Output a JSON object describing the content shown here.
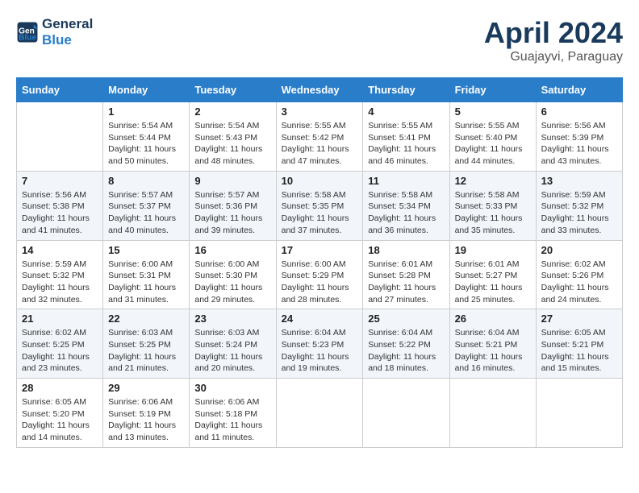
{
  "header": {
    "logo_line1": "General",
    "logo_line2": "Blue",
    "month_title": "April 2024",
    "subtitle": "Guajayvi, Paraguay"
  },
  "weekdays": [
    "Sunday",
    "Monday",
    "Tuesday",
    "Wednesday",
    "Thursday",
    "Friday",
    "Saturday"
  ],
  "weeks": [
    [
      null,
      {
        "day": 1,
        "sunrise": "5:54 AM",
        "sunset": "5:44 PM",
        "daylight": "11 hours and 50 minutes."
      },
      {
        "day": 2,
        "sunrise": "5:54 AM",
        "sunset": "5:43 PM",
        "daylight": "11 hours and 48 minutes."
      },
      {
        "day": 3,
        "sunrise": "5:55 AM",
        "sunset": "5:42 PM",
        "daylight": "11 hours and 47 minutes."
      },
      {
        "day": 4,
        "sunrise": "5:55 AM",
        "sunset": "5:41 PM",
        "daylight": "11 hours and 46 minutes."
      },
      {
        "day": 5,
        "sunrise": "5:55 AM",
        "sunset": "5:40 PM",
        "daylight": "11 hours and 44 minutes."
      },
      {
        "day": 6,
        "sunrise": "5:56 AM",
        "sunset": "5:39 PM",
        "daylight": "11 hours and 43 minutes."
      }
    ],
    [
      {
        "day": 7,
        "sunrise": "5:56 AM",
        "sunset": "5:38 PM",
        "daylight": "11 hours and 41 minutes."
      },
      {
        "day": 8,
        "sunrise": "5:57 AM",
        "sunset": "5:37 PM",
        "daylight": "11 hours and 40 minutes."
      },
      {
        "day": 9,
        "sunrise": "5:57 AM",
        "sunset": "5:36 PM",
        "daylight": "11 hours and 39 minutes."
      },
      {
        "day": 10,
        "sunrise": "5:58 AM",
        "sunset": "5:35 PM",
        "daylight": "11 hours and 37 minutes."
      },
      {
        "day": 11,
        "sunrise": "5:58 AM",
        "sunset": "5:34 PM",
        "daylight": "11 hours and 36 minutes."
      },
      {
        "day": 12,
        "sunrise": "5:58 AM",
        "sunset": "5:33 PM",
        "daylight": "11 hours and 35 minutes."
      },
      {
        "day": 13,
        "sunrise": "5:59 AM",
        "sunset": "5:32 PM",
        "daylight": "11 hours and 33 minutes."
      }
    ],
    [
      {
        "day": 14,
        "sunrise": "5:59 AM",
        "sunset": "5:32 PM",
        "daylight": "11 hours and 32 minutes."
      },
      {
        "day": 15,
        "sunrise": "6:00 AM",
        "sunset": "5:31 PM",
        "daylight": "11 hours and 31 minutes."
      },
      {
        "day": 16,
        "sunrise": "6:00 AM",
        "sunset": "5:30 PM",
        "daylight": "11 hours and 29 minutes."
      },
      {
        "day": 17,
        "sunrise": "6:00 AM",
        "sunset": "5:29 PM",
        "daylight": "11 hours and 28 minutes."
      },
      {
        "day": 18,
        "sunrise": "6:01 AM",
        "sunset": "5:28 PM",
        "daylight": "11 hours and 27 minutes."
      },
      {
        "day": 19,
        "sunrise": "6:01 AM",
        "sunset": "5:27 PM",
        "daylight": "11 hours and 25 minutes."
      },
      {
        "day": 20,
        "sunrise": "6:02 AM",
        "sunset": "5:26 PM",
        "daylight": "11 hours and 24 minutes."
      }
    ],
    [
      {
        "day": 21,
        "sunrise": "6:02 AM",
        "sunset": "5:25 PM",
        "daylight": "11 hours and 23 minutes."
      },
      {
        "day": 22,
        "sunrise": "6:03 AM",
        "sunset": "5:25 PM",
        "daylight": "11 hours and 21 minutes."
      },
      {
        "day": 23,
        "sunrise": "6:03 AM",
        "sunset": "5:24 PM",
        "daylight": "11 hours and 20 minutes."
      },
      {
        "day": 24,
        "sunrise": "6:04 AM",
        "sunset": "5:23 PM",
        "daylight": "11 hours and 19 minutes."
      },
      {
        "day": 25,
        "sunrise": "6:04 AM",
        "sunset": "5:22 PM",
        "daylight": "11 hours and 18 minutes."
      },
      {
        "day": 26,
        "sunrise": "6:04 AM",
        "sunset": "5:21 PM",
        "daylight": "11 hours and 16 minutes."
      },
      {
        "day": 27,
        "sunrise": "6:05 AM",
        "sunset": "5:21 PM",
        "daylight": "11 hours and 15 minutes."
      }
    ],
    [
      {
        "day": 28,
        "sunrise": "6:05 AM",
        "sunset": "5:20 PM",
        "daylight": "11 hours and 14 minutes."
      },
      {
        "day": 29,
        "sunrise": "6:06 AM",
        "sunset": "5:19 PM",
        "daylight": "11 hours and 13 minutes."
      },
      {
        "day": 30,
        "sunrise": "6:06 AM",
        "sunset": "5:18 PM",
        "daylight": "11 hours and 11 minutes."
      },
      null,
      null,
      null,
      null
    ]
  ]
}
